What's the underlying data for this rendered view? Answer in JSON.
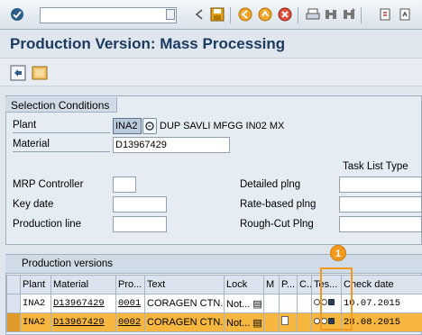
{
  "window": {
    "title": "Production Version: Mass Processing"
  },
  "toolbar": {
    "command_field_value": "",
    "icons": [
      "enter-icon",
      "save-icon",
      "back-icon",
      "exit-icon",
      "cancel-icon",
      "print-icon",
      "find-icon",
      "find-next-icon",
      "first-page-icon",
      "previous-page-icon"
    ]
  },
  "app_toolbar": {
    "icons": [
      "execute-icon",
      "variant-icon"
    ]
  },
  "selection": {
    "heading": "Selection Conditions",
    "plant_label": "Plant",
    "plant_value": "INA2",
    "plant_description": "DUP SAVLI MFGG IN02 MX",
    "material_label": "Material",
    "material_value": "D13967429",
    "task_list_type_label": "Task List Type",
    "mrp_controller_label": "MRP Controller",
    "mrp_controller_value": "",
    "key_date_label": "Key date",
    "key_date_value": "",
    "production_line_label": "Production line",
    "production_line_value": "",
    "detailed_plng_label": "Detailed plng",
    "detailed_plng_value": "",
    "rate_based_plng_label": "Rate-based plng",
    "rate_based_plng_value": "",
    "rough_cut_plng_label": "Rough-Cut Plng",
    "rough_cut_plng_value": ""
  },
  "production_versions": {
    "heading": "Production versions",
    "columns": [
      "Plant",
      "Material",
      "Pro...",
      "Text",
      "Lock",
      "M",
      "P...",
      "C..",
      "Tes...",
      "Check date"
    ],
    "rows": [
      {
        "plant": "INA2",
        "material": "D13967429",
        "version": "0001",
        "text": "CORAGEN CTN...",
        "lock": "Not...",
        "check_date": "10.07.2015",
        "highlighted": false
      },
      {
        "plant": "INA2",
        "material": "D13967429",
        "version": "0002",
        "text": "CORAGEN CTN...",
        "lock": "Not...",
        "check_date": "28.08.2015",
        "highlighted": true
      }
    ]
  },
  "callout": {
    "number": "1"
  },
  "colors": {
    "title": "#1c3a5e",
    "highlight_row": "#f7b63d",
    "callout": "#f39a1e"
  }
}
